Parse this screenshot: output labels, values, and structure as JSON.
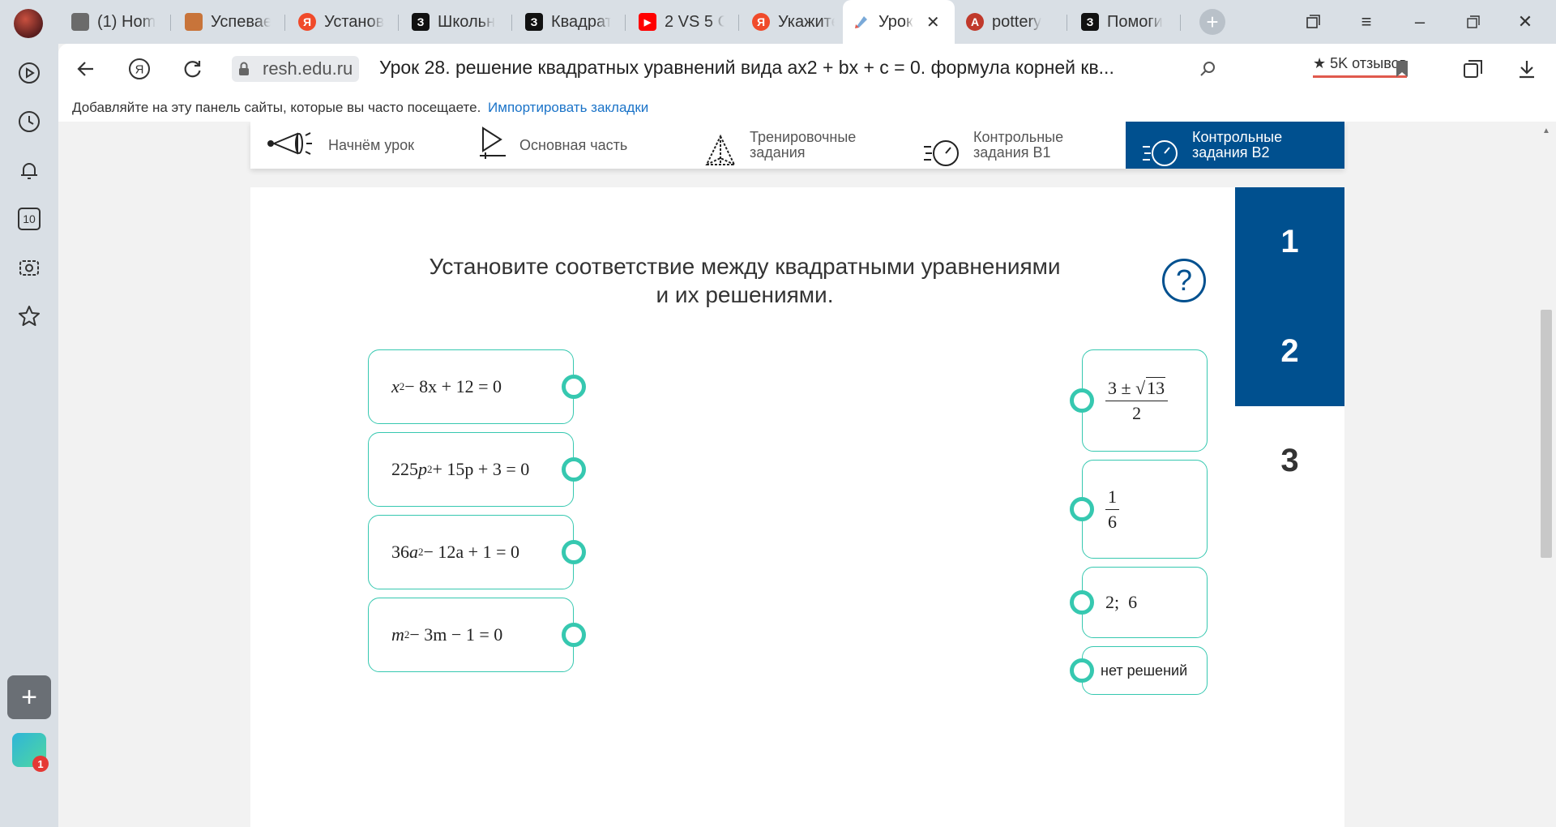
{
  "tabs": [
    {
      "title": "(1) Hom",
      "icon": "roblox-icon",
      "color": "#6b6b6b",
      "glyph": ""
    },
    {
      "title": "Успевае",
      "icon": "book-icon",
      "color": "#c8743a",
      "glyph": ""
    },
    {
      "title": "Установ",
      "icon": "yandex-icon",
      "color": "#f04a2a",
      "glyph": "Я"
    },
    {
      "title": "Школьн",
      "icon": "znanija-icon",
      "color": "#111111",
      "glyph": "З"
    },
    {
      "title": "Квадрат",
      "icon": "znanija-icon",
      "color": "#111111",
      "glyph": "З"
    },
    {
      "title": "2 VS 5 C",
      "icon": "youtube-icon",
      "color": "#ff0000",
      "glyph": "▶"
    },
    {
      "title": "Укажите",
      "icon": "yandex-icon",
      "color": "#f04a2a",
      "glyph": "Я"
    },
    {
      "title": "Урок",
      "icon": "resh-icon",
      "color": "#ffffff",
      "glyph": "",
      "active": true
    },
    {
      "title": "pottery",
      "icon": "translate-icon",
      "color": "#c0392b",
      "glyph": "A"
    },
    {
      "title": "Помоги",
      "icon": "znanija-icon",
      "color": "#111111",
      "glyph": "З"
    }
  ],
  "browser": {
    "domain": "resh.edu.ru",
    "page_title": "Урок 28. решение квадратных уравнений вида ax2 + bx + c = 0. формула корней кв...",
    "reviews": "★ 5K отзывов",
    "bookmarks_hint": "Добавляйте на эту панель сайты, которые вы часто посещаете.",
    "bookmarks_import": "Импортировать закладки",
    "messenger_badge": "1",
    "sidebar_counter": "10"
  },
  "lesson_nav": [
    {
      "label": "Начнём урок",
      "icon": "megaphone-icon"
    },
    {
      "label": "Основная часть",
      "icon": "play-icon"
    },
    {
      "label": "Тренировочные\nзадания",
      "icon": "pyramid-icon"
    },
    {
      "label": "Контрольные\nзадания В1",
      "icon": "stopwatch-icon"
    },
    {
      "label": "Контрольные\nзадания В2",
      "icon": "stopwatch-icon",
      "active": true
    }
  ],
  "task": {
    "question_line1": "Установите соответствие между квадратными уравнениями",
    "question_line2": "и их решениями.",
    "help": "?",
    "steps": [
      "1",
      "2",
      "3"
    ],
    "equations": [
      {
        "a": "x",
        "rest": " − 8x + 12 = 0",
        "coef": ""
      },
      {
        "a": "p",
        "rest": " + 15p + 3 = 0",
        "coef": "225"
      },
      {
        "a": "a",
        "rest": " − 12a + 1 = 0",
        "coef": "36"
      },
      {
        "a": "m",
        "rest": " − 3m − 1 = 0",
        "coef": ""
      }
    ],
    "exponent": "2",
    "answers": {
      "frac1_num_prefix": "3 ±",
      "frac1_sqrt": "13",
      "frac1_den": "2",
      "frac2_num": "1",
      "frac2_den": "6",
      "pair": "2;  6",
      "none": "нет решений"
    }
  }
}
